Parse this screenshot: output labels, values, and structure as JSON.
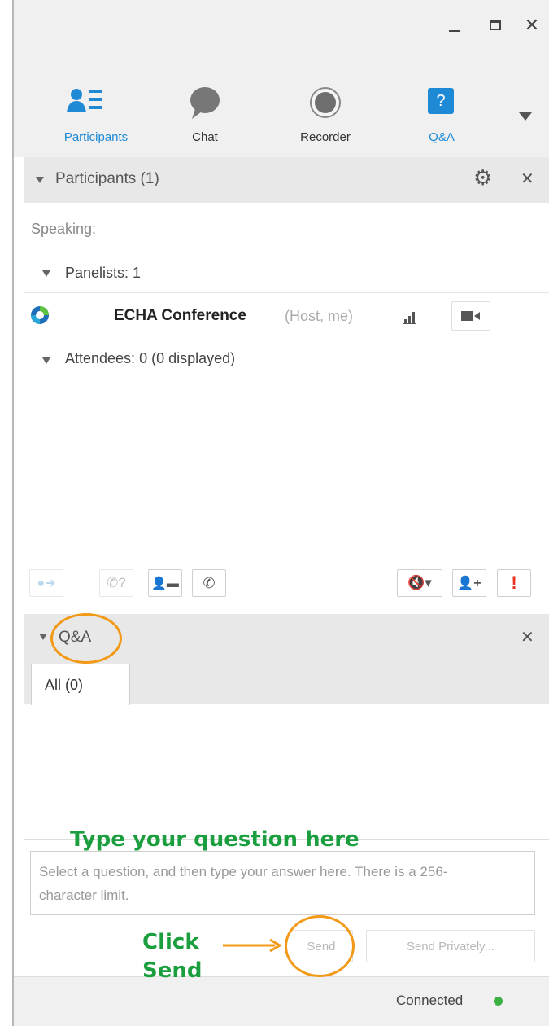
{
  "toolbar": {
    "items": [
      {
        "label": "Participants",
        "icon": "participants-icon",
        "active": true
      },
      {
        "label": "Chat",
        "icon": "chat-bubble-icon"
      },
      {
        "label": "Recorder",
        "icon": "record-icon"
      },
      {
        "label": "Q&A",
        "icon": "qa-icon",
        "active": true
      }
    ]
  },
  "participants": {
    "title": "Participants (1)",
    "speaking": "Speaking:",
    "panelists": "Panelists: 1",
    "host_name": "ECHA Conference",
    "host_tag": "(Host, me)",
    "attendees": "Attendees: 0 (0 displayed)"
  },
  "qa": {
    "title": "Q&A",
    "tab_all": "All (0)",
    "input_placeholder": "Select a question, and then type your answer here. There is a 256-character limit.",
    "send": "Send",
    "send_privately": "Send Privately..."
  },
  "status": {
    "text": "Connected",
    "color": "#3cb043"
  },
  "annotations": {
    "type_here": "Type your question here",
    "click": "Click",
    "send": "Send"
  },
  "colors": {
    "accent": "#1e8ad6",
    "annotation_green": "#1a9e3e",
    "annotation_orange": "#f29a17"
  }
}
